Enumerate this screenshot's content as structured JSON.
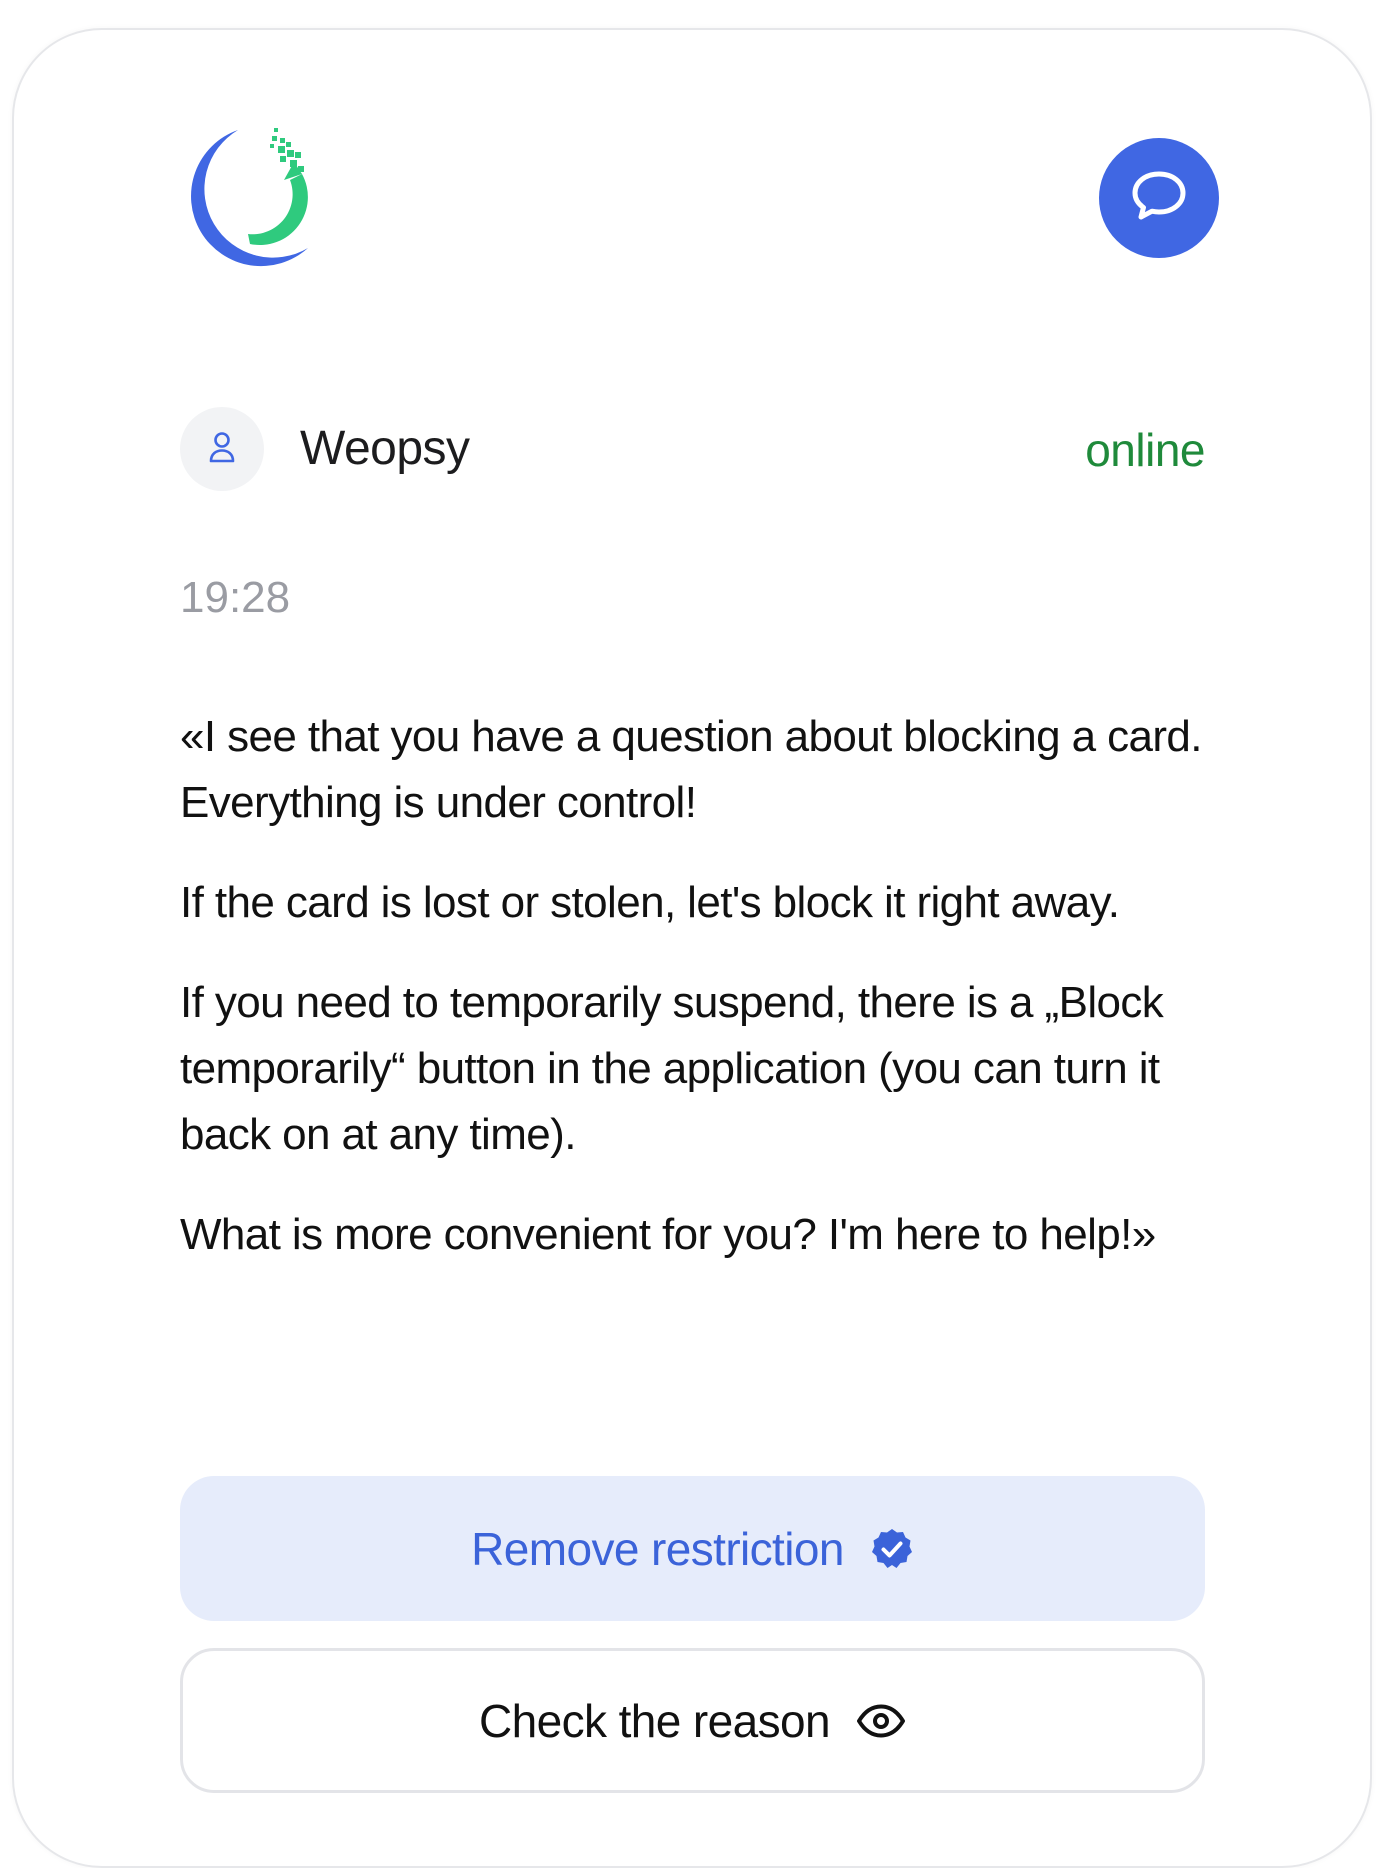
{
  "header": {
    "logo_icon": "crescent-logo-icon",
    "chat_icon": "chat-bubble-icon",
    "accent_color": "#4067e3"
  },
  "agent": {
    "avatar_icon": "user-icon",
    "name": "Weopsy",
    "status": "online",
    "status_color": "#1f8a3b"
  },
  "message": {
    "time": "19:28",
    "paragraphs": [
      "«I see that you have a question about blocking a card. Everything is under control!",
      "If the card is lost or stolen, let's block it right away.",
      "If you need to temporarily suspend, there is a „Block temporarily“ button in the application (you can turn it back on at any time).",
      "What is more convenient for you? I'm here to help!»"
    ]
  },
  "actions": {
    "primary_label": "Remove restriction",
    "primary_icon": "check-circle-icon",
    "secondary_label": "Check the reason",
    "secondary_icon": "eye-icon"
  }
}
